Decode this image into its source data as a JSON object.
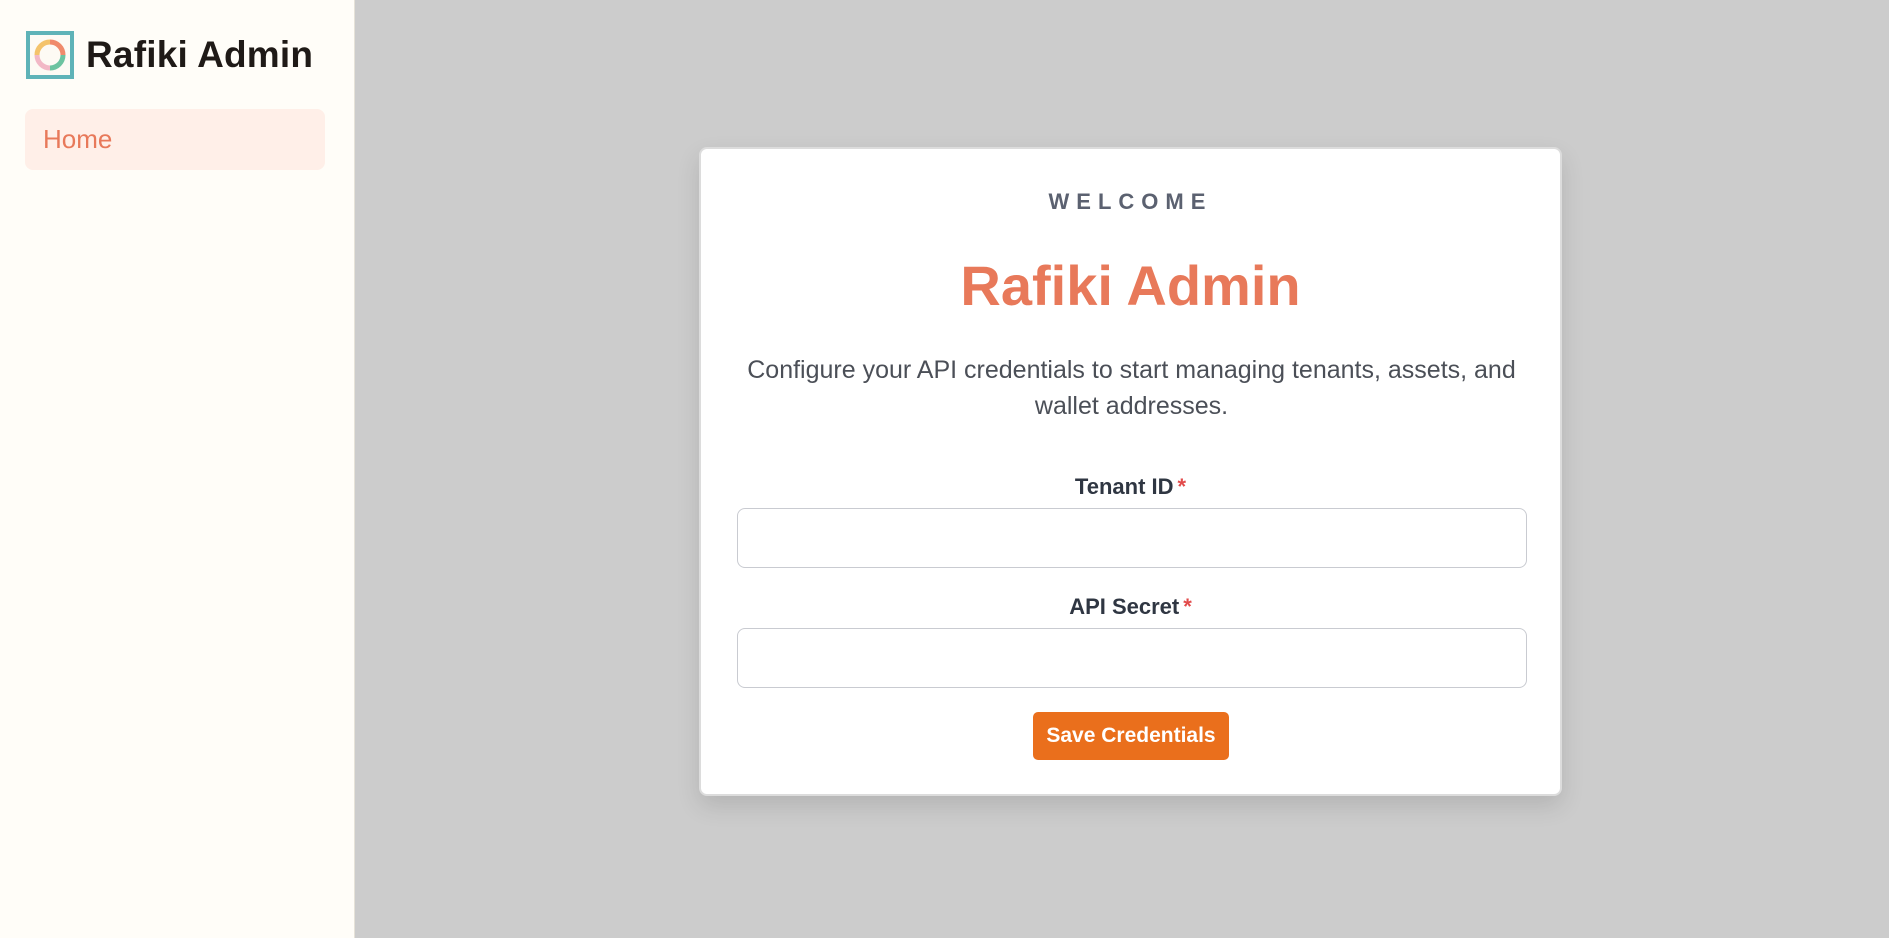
{
  "sidebar": {
    "brand_title": "Rafiki Admin",
    "logo_icon": "rafiki-ring-logo-icon",
    "nav": [
      {
        "label": "Home",
        "active": true
      }
    ]
  },
  "card": {
    "eyebrow": "WELCOME",
    "title": "Rafiki Admin",
    "description": "Configure your API credentials to start managing tenants, assets, and wallet addresses.",
    "fields": {
      "tenant_id": {
        "label": "Tenant ID",
        "required_mark": "*",
        "value": "",
        "placeholder": ""
      },
      "api_secret": {
        "label": "API Secret",
        "required_mark": "*",
        "value": "",
        "placeholder": ""
      }
    },
    "save_label": "Save Credentials"
  },
  "colors": {
    "accent": "#e8795a",
    "button": "#ea6f1c",
    "required": "#e24b4b",
    "logo_border": "#5fb3b8",
    "backdrop": "#cccccc",
    "sidebar_bg": "#fffdf8",
    "nav_active_bg": "#ffefe8"
  }
}
